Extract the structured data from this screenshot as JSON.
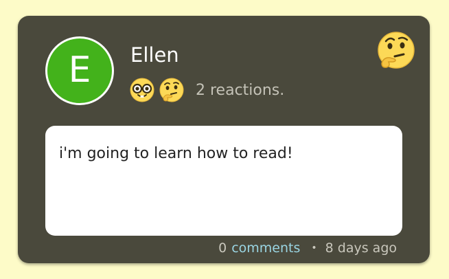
{
  "post": {
    "avatar_letter": "E",
    "author": "Ellen",
    "reactions": [
      "nerd-face-emoji",
      "thinking-face-emoji"
    ],
    "reactions_text": "2 reactions.",
    "add_reaction_icon": "thinking-face-emoji",
    "message": "i'm going to learn how to read!",
    "comment_count": "0",
    "comments_label": "comments",
    "separator": "•",
    "time_ago": "8 days ago"
  },
  "colors": {
    "background": "#fdfbc8",
    "card": "#4a493c",
    "avatar": "#43b21b",
    "link": "#9ad5e3",
    "muted_text": "#c4c2b7",
    "emoji_yellow": "#fcd957"
  }
}
